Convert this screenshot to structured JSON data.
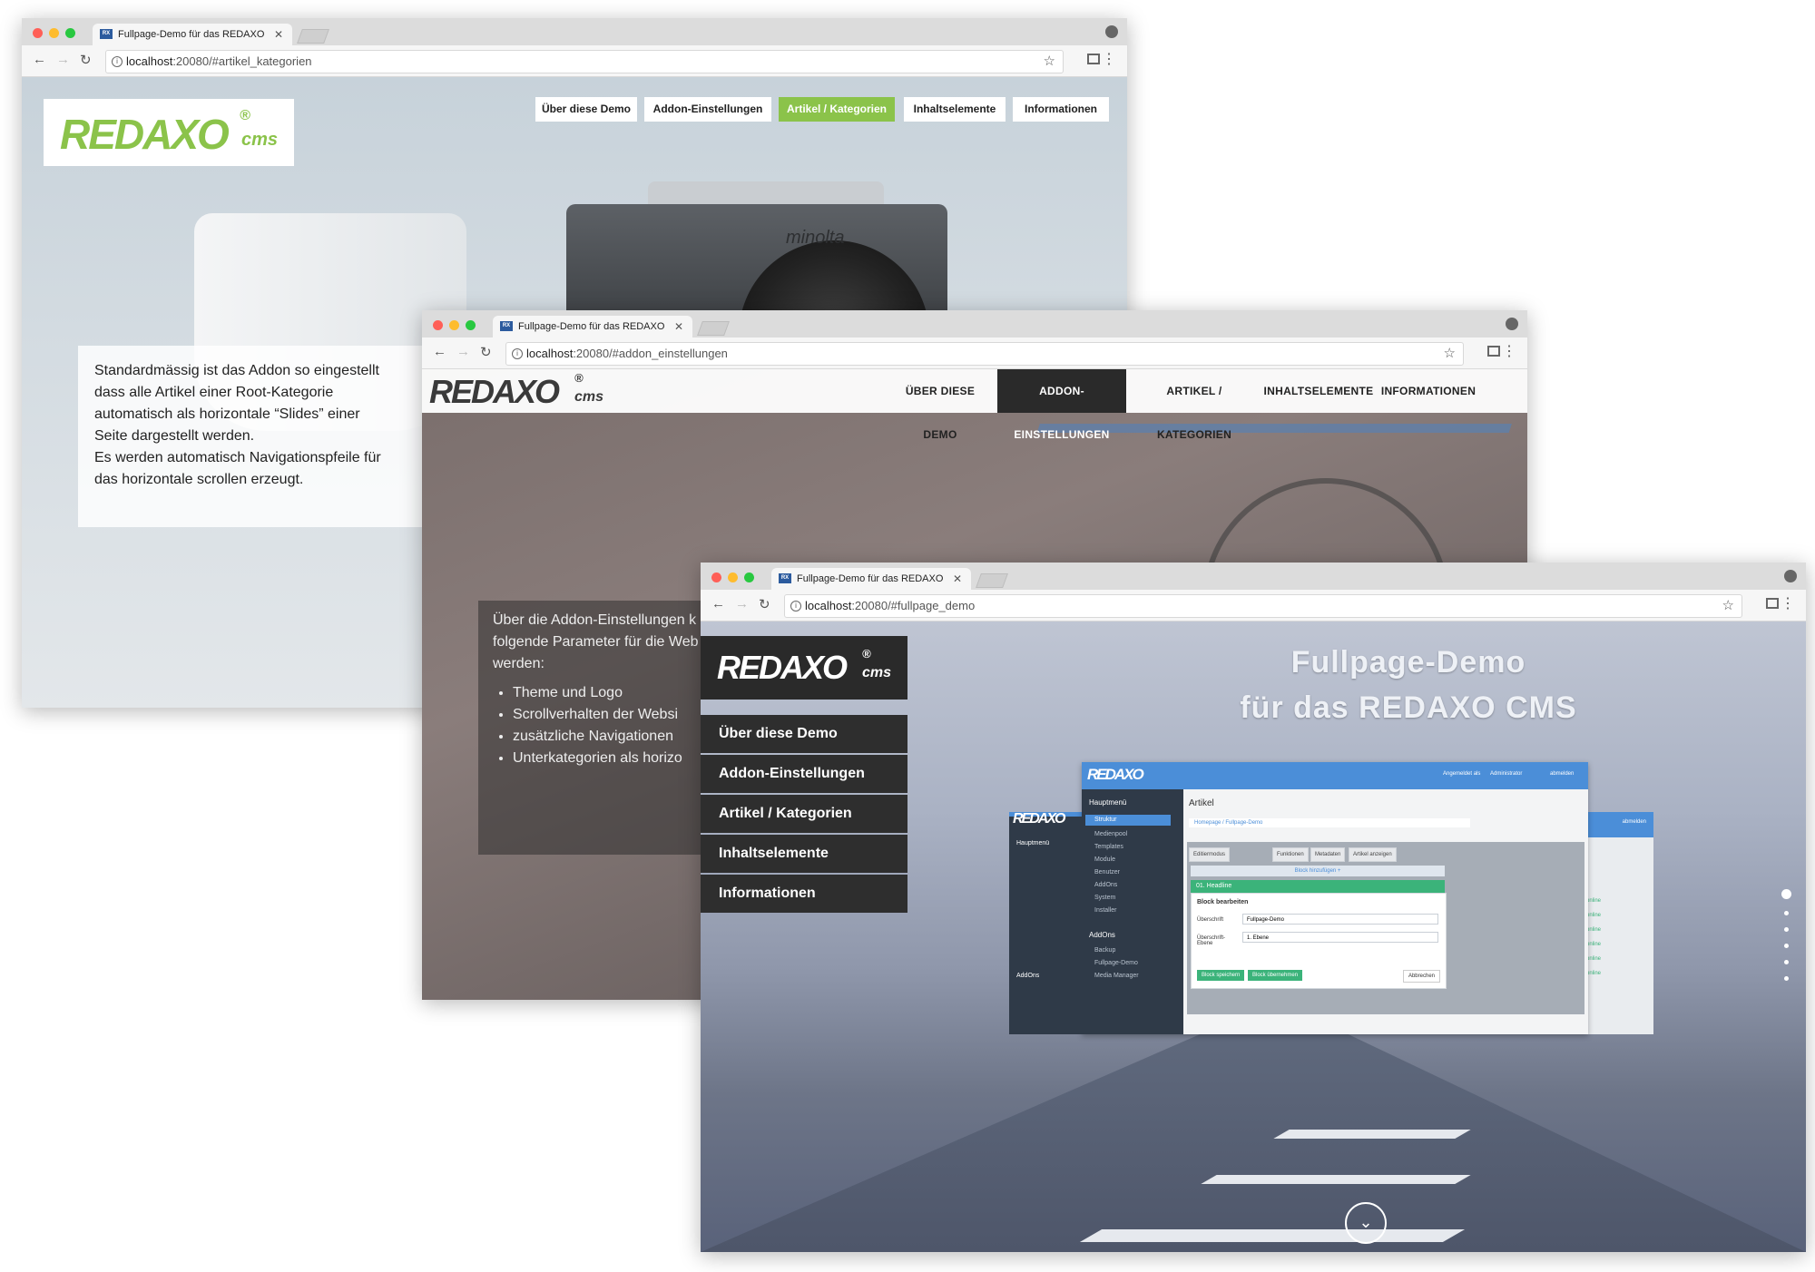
{
  "tab_title": "Fullpage-Demo für das REDAXO",
  "url_host": "localhost",
  "windows": [
    {
      "url_path": ":20080/#artikel_kategorien"
    },
    {
      "url_path": ":20080/#addon_einstellungen"
    },
    {
      "url_path": ":20080/#fullpage_demo"
    }
  ],
  "logo": {
    "main": "REDAXO",
    "sub": "cms",
    "reg": "®"
  },
  "nav": [
    "Über diese Demo",
    "Addon-Einstellungen",
    "Artikel / Kategorien",
    "Inhaltselemente",
    "Informationen"
  ],
  "nav_upper": [
    "ÜBER DIESE DEMO",
    "ADDON-EINSTELLUNGEN",
    "ARTIKEL / KATEGORIEN",
    "INHALTSELEMENTE",
    "INFORMATIONEN"
  ],
  "camera_brand": "minolta",
  "w1_text": [
    "Standardmässig ist das Addon so eingestellt",
    "dass alle Artikel einer Root-Kategorie",
    "automatisch als horizontale “Slides” einer",
    "Seite dargestellt werden.",
    "Es werden automatisch Navigationspfeile für",
    "das horizontale scrollen erzeugt."
  ],
  "w2_text": {
    "intro": [
      "Über die Addon-Einstellungen k",
      "folgende Parameter für die Web",
      "werden:"
    ],
    "bullets": [
      "Theme und Logo",
      "Scrollverhalten der Websi",
      "zusätzliche Navigationen",
      "Unterkategorien als horizo"
    ]
  },
  "w3_title": [
    "Fullpage-Demo",
    "für das REDAXO CMS"
  ],
  "screenshot": {
    "sidebar_title": "Hauptmenü",
    "sidebar_items": [
      "Struktur",
      "Medienpool",
      "Templates",
      "Module",
      "Benutzer",
      "AddOns",
      "System",
      "Installer"
    ],
    "addons_title": "AddOns",
    "addons_items": [
      "Backup",
      "Fullpage-Demo",
      "Media Manager"
    ],
    "page_title": "Artikel",
    "breadcrumb": "Homepage / Fullpage-Demo",
    "tabs": [
      "Editiermodus",
      "Funktionen",
      "Metadaten",
      "Artikel anzeigen"
    ],
    "add_block": "Block hinzufügen +",
    "block_title": "01. Headline",
    "edit_title": "Block bearbeiten",
    "field1_label": "Überschrift",
    "field1_value": "Fullpage-Demo",
    "field2_label": "Überschrift-Ebene",
    "field2_value": "1. Ebene",
    "btn_save": "Block speichern",
    "btn_apply": "Block übernehmen",
    "btn_cancel": "Abbrechen",
    "logged_in": "Angemeldet als",
    "user": "Administrator",
    "logout": "abmelden",
    "online_label": "online"
  }
}
